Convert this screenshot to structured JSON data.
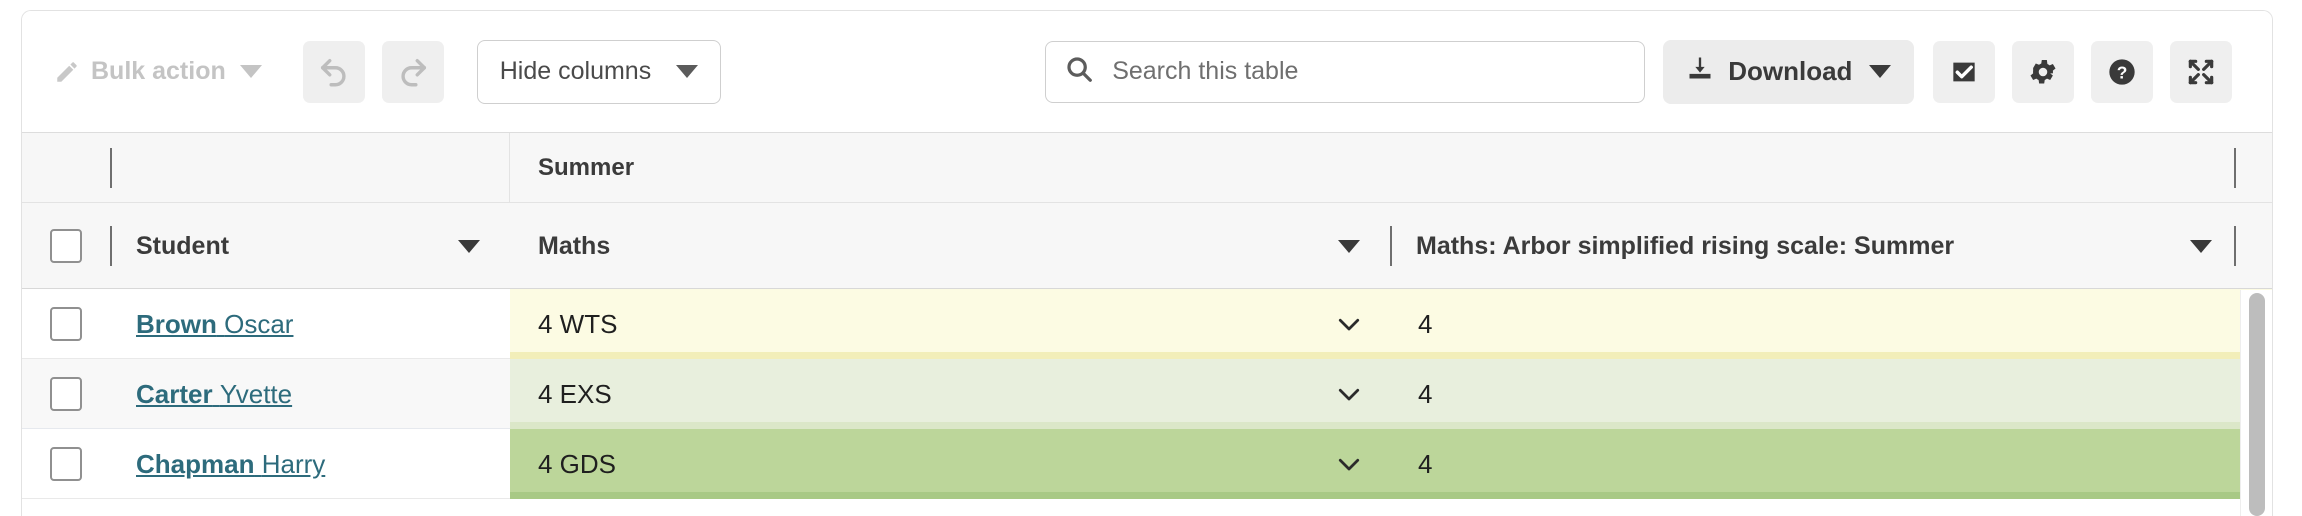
{
  "toolbar": {
    "bulk_action_label": "Bulk action",
    "bulk_action_icon": "pencil-icon",
    "undo_icon": "undo-arrow-icon",
    "redo_icon": "redo-arrow-icon",
    "hide_columns_label": "Hide columns",
    "search_placeholder": "Search this table",
    "search_value": "",
    "search_icon": "search-icon",
    "download_label": "Download",
    "download_icon": "download-icon",
    "select_all_icon": "checkbox-checked-icon",
    "settings_icon": "gear-icon",
    "help_icon": "question-mark-circle-icon",
    "fullscreen_icon": "expand-arrows-icon"
  },
  "table": {
    "group_headers": [
      {
        "label": "",
        "span": "student"
      },
      {
        "label": "Summer",
        "span": "assessment"
      }
    ],
    "columns": [
      {
        "key": "checkbox",
        "label": "",
        "sortable": false
      },
      {
        "key": "student",
        "label": "Student",
        "sortable": true
      },
      {
        "key": "maths",
        "label": "Maths",
        "sortable": true
      },
      {
        "key": "scale",
        "label": "Maths: Arbor simplified rising scale: Summer",
        "sortable": true
      }
    ],
    "rows": [
      {
        "surname": "Brown",
        "forename": "Oscar",
        "maths": "4 WTS",
        "scale": "4",
        "row_bg": "#fcfbe3",
        "row_bar": "#f2eeb9",
        "alt": false
      },
      {
        "surname": "Carter",
        "forename": "Yvette",
        "maths": "4 EXS",
        "scale": "4",
        "row_bg": "#e8efdd",
        "row_bar": "#dbe7c8",
        "alt": true
      },
      {
        "surname": "Chapman",
        "forename": "Harry",
        "maths": "4 GDS",
        "scale": "4",
        "row_bg": "#bcd69a",
        "row_bar": "#a8c985",
        "alt": false
      }
    ]
  },
  "colors": {
    "link": "#2d6b7c",
    "toolbar_bg": "#ffffff",
    "header_bg": "#f7f7f7",
    "disabled_text": "#c4c4c4",
    "scrollbar": "#bdbdbd"
  }
}
